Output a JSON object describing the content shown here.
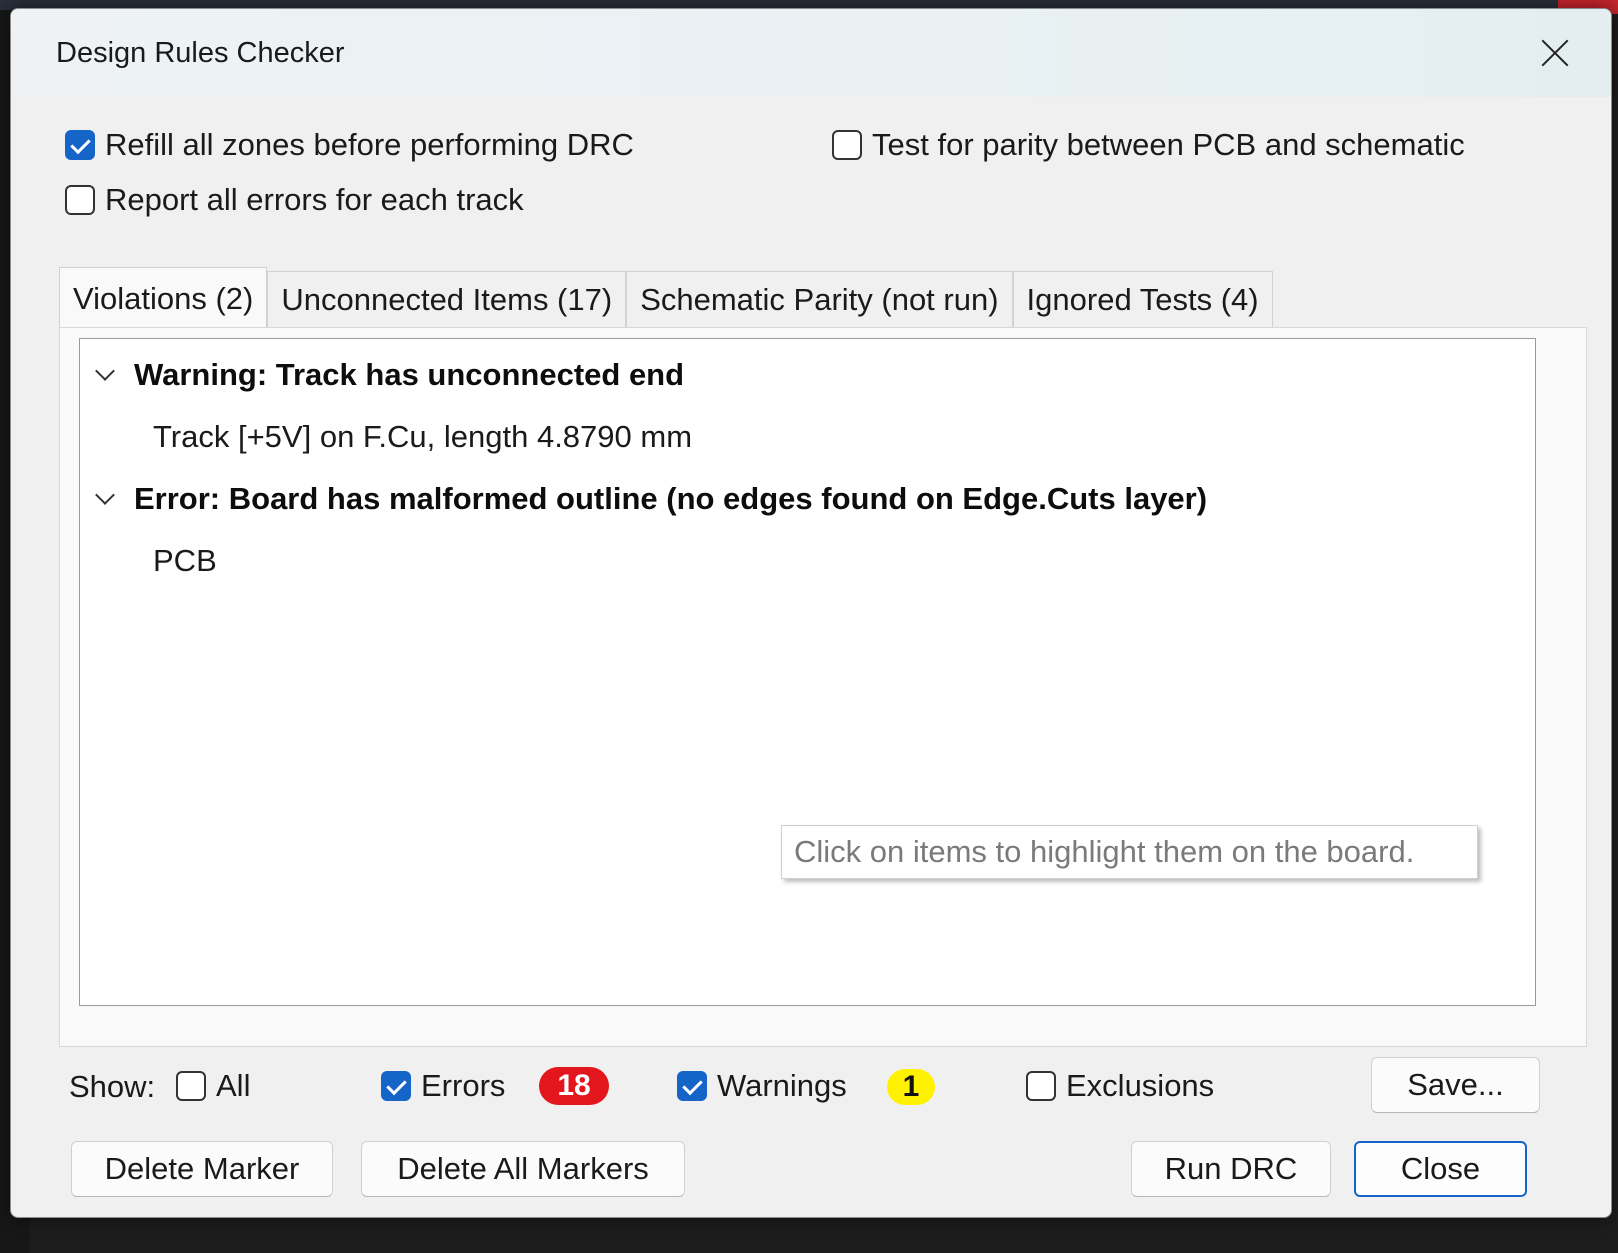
{
  "dialog": {
    "title": "Design Rules Checker"
  },
  "options": {
    "refill_zones": {
      "label": "Refill all zones before performing DRC",
      "checked": true
    },
    "report_all_errors": {
      "label": "Report all errors for each track",
      "checked": false
    },
    "test_parity": {
      "label": "Test for parity between PCB and schematic",
      "checked": false
    }
  },
  "tabs": [
    {
      "label": "Violations (2)",
      "active": true
    },
    {
      "label": "Unconnected Items (17)",
      "active": false
    },
    {
      "label": "Schematic Parity (not run)",
      "active": false
    },
    {
      "label": "Ignored Tests (4)",
      "active": false
    }
  ],
  "violations": [
    {
      "heading": "Warning: Track has unconnected end",
      "detail": "Track [+5V] on F.Cu, length 4.8790 mm",
      "expanded": true
    },
    {
      "heading": "Error: Board has malformed outline (no edges found on Edge.Cuts layer)",
      "detail": "PCB",
      "expanded": true
    }
  ],
  "tooltip": "Click on items to highlight them on the board.",
  "show": {
    "label": "Show:",
    "all": {
      "label": "All",
      "checked": false
    },
    "errors": {
      "label": "Errors",
      "checked": true,
      "count": "18",
      "badge_color": "#e4161d"
    },
    "warnings": {
      "label": "Warnings",
      "checked": true,
      "count": "1",
      "badge_color": "#fff200"
    },
    "exclusions": {
      "label": "Exclusions",
      "checked": false
    }
  },
  "buttons": {
    "save": "Save...",
    "delete_marker": "Delete Marker",
    "delete_all_markers": "Delete All Markers",
    "run_drc": "Run DRC",
    "close": "Close"
  },
  "colors": {
    "accent": "#1565c8"
  }
}
